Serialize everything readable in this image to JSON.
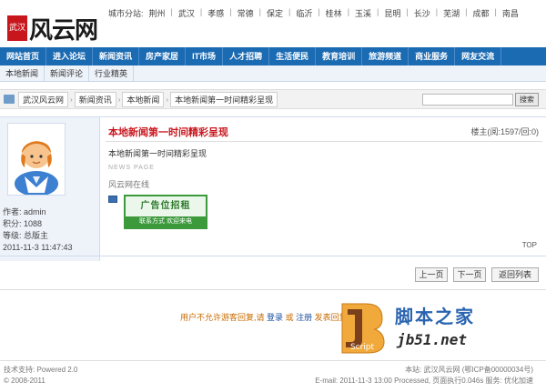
{
  "site": {
    "logo_seal": "武汉",
    "logo_text": "风云网",
    "cities_label": "城市分站:",
    "cities": [
      "荆州",
      "武汉",
      "孝感",
      "常德",
      "保定",
      "临沂",
      "桂林",
      "玉溪",
      "昆明",
      "长沙",
      "芜湖",
      "成都",
      "南昌"
    ]
  },
  "nav": {
    "items": [
      "网站首页",
      "进入论坛",
      "新闻资讯",
      "房产家居",
      "IT市场",
      "人才招聘",
      "生活便民",
      "教育培训",
      "旅游频道",
      "商业服务",
      "网友交流"
    ]
  },
  "subnav": {
    "items": [
      "本地新闻",
      "新闻评论",
      "行业精英"
    ]
  },
  "breadcrumb": {
    "items": [
      "武汉风云网",
      "新闻资讯",
      "本地新闻",
      "本地新闻第一时间精彩呈现"
    ]
  },
  "search": {
    "placeholder": "",
    "button": "搜索"
  },
  "post": {
    "title": "本地新闻第一时间精彩呈现",
    "floor": "楼主(阅:1597/回:0)",
    "body": "本地新闻第一时间精彩呈现",
    "meta": "NEWS PAGE",
    "signature": "风云网在线",
    "ad_title": "广告位招租",
    "ad_footer": "联系方式 欢迎来电",
    "top_link": "TOP"
  },
  "author": {
    "name_line": "作者: admin",
    "posts_line": "积分: 1088",
    "level_line": "等级: 总版主",
    "time_line": "2011-11-3 11:47:43"
  },
  "pager": {
    "prev": "上一页",
    "next": "下一页",
    "back": "返回列表"
  },
  "reply": {
    "text": "用户不允许游客回复,请",
    "login": "登录",
    "or": "或",
    "register": "注册",
    "suffix": "发表回复"
  },
  "watermark": {
    "logo": "JB",
    "logo_sub": "Script",
    "cn": "脚本之家",
    "url": "jb51.net"
  },
  "footer": {
    "left_line1": "技术支持: Powered 2.0",
    "left_line2": "© 2008-2011",
    "right_line1": "本站: 武汉风云网 (鄂ICP备00000034号)",
    "right_line2": "E-mail: 2011-11-3 13:00 Processed, 页面执行0.046s 服务: 优化加速"
  },
  "colors": {
    "nav_bg": "#1b6bb3",
    "title_red": "#c8161d",
    "ad_green": "#3c9a3c"
  }
}
